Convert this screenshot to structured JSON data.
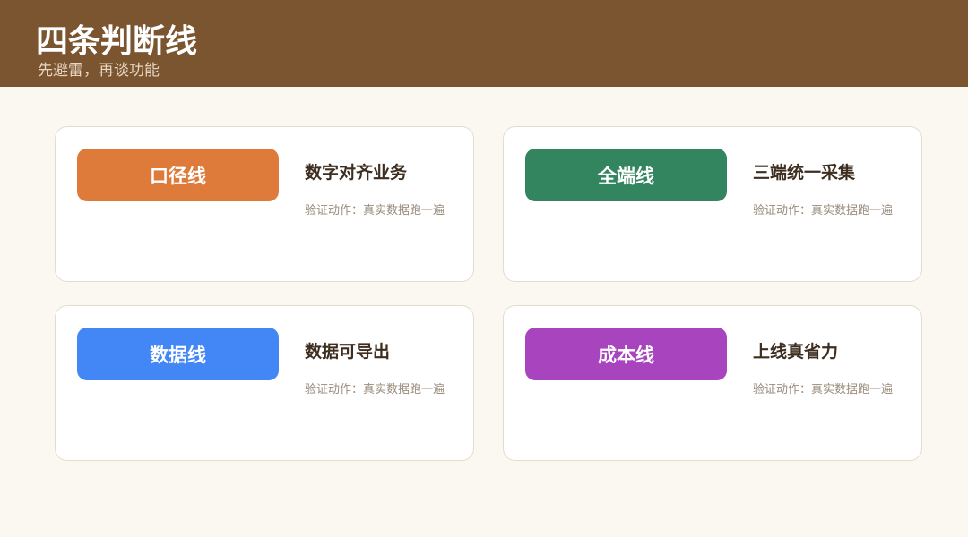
{
  "header": {
    "title": "四条判断线",
    "subtitle": "先避雷，再谈功能",
    "background": "#7b5530"
  },
  "cards": [
    {
      "label": "口径线",
      "title": "数字对齐业务",
      "note": "验证动作：真实数据跑一遍",
      "color": "#de7b3b"
    },
    {
      "label": "全端线",
      "title": "三端统一采集",
      "note": "验证动作：真实数据跑一遍",
      "color": "#338560"
    },
    {
      "label": "数据线",
      "title": "数据可导出",
      "note": "验证动作：真实数据跑一遍",
      "color": "#4287f5"
    },
    {
      "label": "成本线",
      "title": "上线真省力",
      "note": "验证动作：真实数据跑一遍",
      "color": "#a844bd"
    }
  ]
}
